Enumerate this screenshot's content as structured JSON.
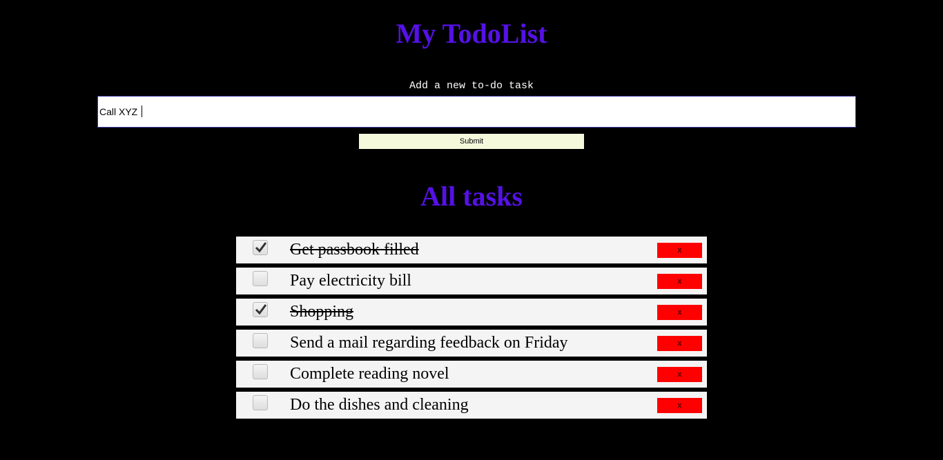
{
  "header": {
    "title": "My TodoList"
  },
  "form": {
    "label": "Add a new to-do task",
    "input_value": "Call XYZ ",
    "submit_label": "Submit"
  },
  "tasks_section": {
    "title": "All tasks"
  },
  "tasks": [
    {
      "text": "Get passbook filled",
      "done": true,
      "delete_label": "x"
    },
    {
      "text": "Pay electricity bill",
      "done": false,
      "delete_label": "x"
    },
    {
      "text": "Shopping",
      "done": true,
      "delete_label": "x"
    },
    {
      "text": "Send a mail regarding feedback on Friday",
      "done": false,
      "delete_label": "x"
    },
    {
      "text": "Complete reading novel",
      "done": false,
      "delete_label": "x"
    },
    {
      "text": "Do the dishes and cleaning",
      "done": false,
      "delete_label": "x"
    }
  ],
  "colors": {
    "background": "#000000",
    "heading": "#5511e6",
    "submit_bg": "#f5f9dc",
    "delete_bg": "#ff0000",
    "row_bg": "#f4f4f4"
  }
}
